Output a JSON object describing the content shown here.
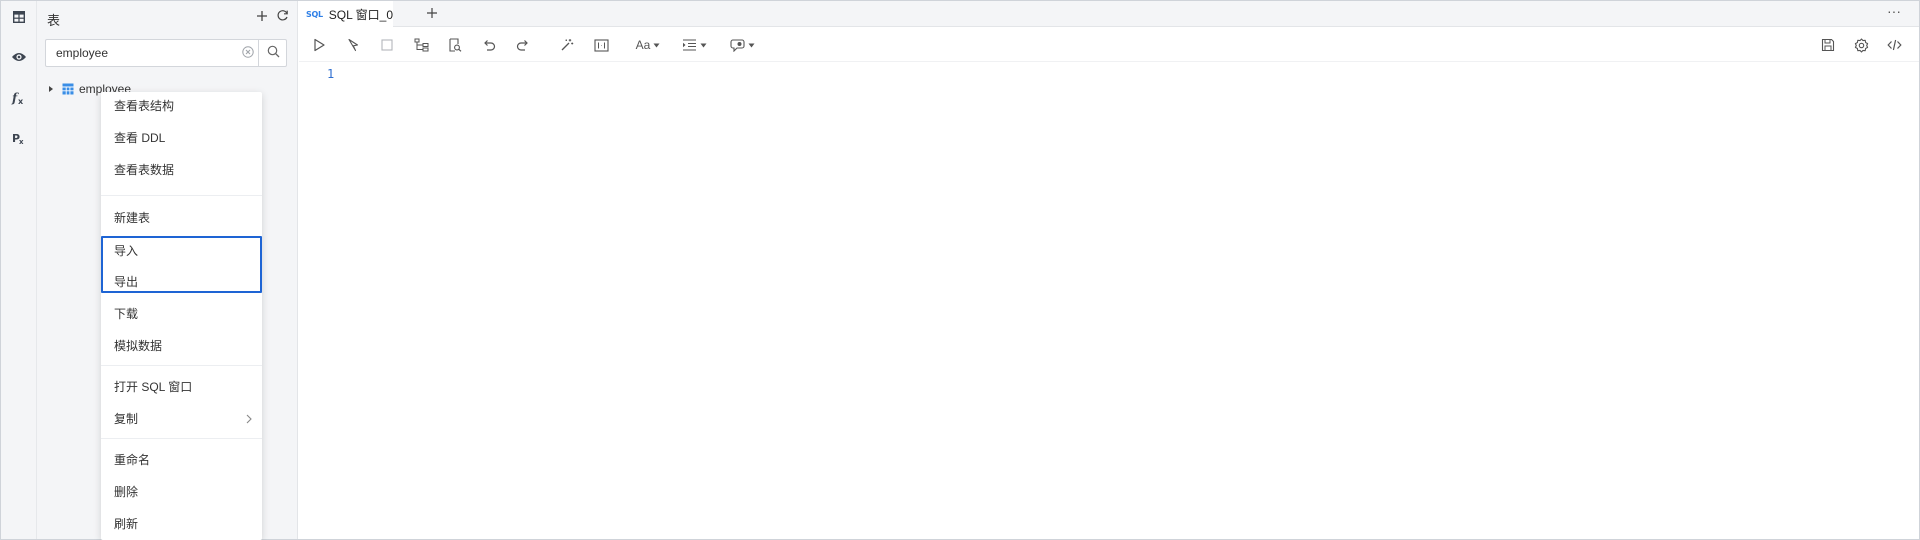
{
  "panel": {
    "title": "表",
    "search": {
      "value": "employee",
      "placeholder": ""
    }
  },
  "tree": {
    "node_label": "employee"
  },
  "context_menu": {
    "items": [
      "查看表结构",
      "查看 DDL",
      "查看表数据",
      "新建表",
      "导入",
      "导出",
      "下载",
      "模拟数据",
      "打开 SQL 窗口",
      "复制",
      "重命名",
      "删除",
      "刷新"
    ]
  },
  "tabs": {
    "active": {
      "icon_text": "SQL",
      "label": "SQL 窗口_0"
    },
    "more_label": "···"
  },
  "toolbar": {
    "font_label": "Aa"
  },
  "editor": {
    "line_numbers": [
      "1"
    ]
  },
  "colors": {
    "accent": "#1e64d4",
    "icon": "#555555",
    "panel_bg": "#f4f5f7",
    "sql_icon": "#2f7fe6",
    "table_icon": "#3a8ee6"
  },
  "icons": {
    "activity": [
      "table-icon",
      "view-icon",
      "function-icon",
      "procedure-icon"
    ]
  }
}
